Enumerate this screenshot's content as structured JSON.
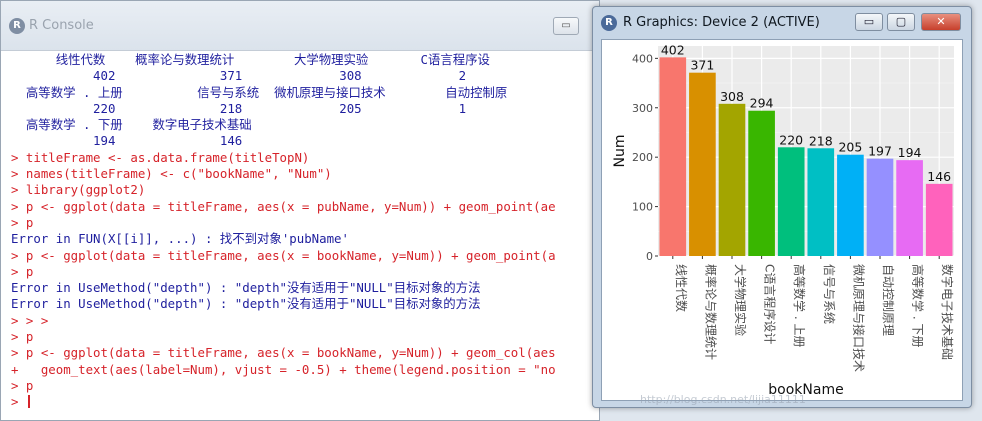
{
  "console": {
    "title": "R Console",
    "controls": {
      "minimize": "▭",
      "maximize": "▢"
    },
    "lines": [
      {
        "text": "      线性代数    概率论与数理统计        大学物理实验       C语言程序设",
        "color": "blue"
      },
      {
        "text": "           402              371             308             2",
        "color": "blue"
      },
      {
        "text": "  高等数学 . 上册          信号与系统  微机原理与接口技术        自动控制原",
        "color": "blue"
      },
      {
        "text": "           220              218             205             1",
        "color": "blue"
      },
      {
        "text": "  高等数学 . 下册    数字电子技术基础",
        "color": "blue"
      },
      {
        "text": "           194              146",
        "color": "blue"
      },
      {
        "text": "> titleFrame <- as.data.frame(titleTopN)",
        "color": "red"
      },
      {
        "text": "> names(titleFrame) <- c(\"bookName\", \"Num\")",
        "color": "red"
      },
      {
        "text": "> library(ggplot2)",
        "color": "red"
      },
      {
        "text": "> p <- ggplot(data = titleFrame, aes(x = pubName, y=Num)) + geom_point(ae",
        "color": "red"
      },
      {
        "text": "> p",
        "color": "red"
      },
      {
        "text": "Error in FUN(X[[i]], ...) : 找不到对象'pubName'",
        "color": "blue"
      },
      {
        "text": "> p <- ggplot(data = titleFrame, aes(x = bookName, y=Num)) + geom_point(a",
        "color": "red"
      },
      {
        "text": "> p",
        "color": "red"
      },
      {
        "text": "Error in UseMethod(\"depth\") : \"depth\"没有适用于\"NULL\"目标对象的方法",
        "color": "blue"
      },
      {
        "text": "Error in UseMethod(\"depth\") : \"depth\"没有适用于\"NULL\"目标对象的方法",
        "color": "blue"
      },
      {
        "text": "> > >",
        "color": "red"
      },
      {
        "text": "> p",
        "color": "red"
      },
      {
        "text": "> p <- ggplot(data = titleFrame, aes(x = bookName, y=Num)) + geom_col(aes",
        "color": "red"
      },
      {
        "text": "+   geom_text(aes(label=Num), vjust = -0.5) + theme(legend.position = \"no",
        "color": "red"
      },
      {
        "text": "> p",
        "color": "red"
      },
      {
        "text": "> ",
        "color": "red",
        "cursor": true
      }
    ]
  },
  "graphics": {
    "title": "R Graphics: Device 2 (ACTIVE)",
    "controls": {
      "minimize": "▭",
      "maximize": "▢",
      "close": "✕"
    }
  },
  "watermark": "http://blog.csdn.net/lijia11111",
  "chart_data": {
    "type": "bar",
    "categories": [
      "线性代数",
      "概率论与数理统计",
      "大学物理实验",
      "C语言程序设计",
      "高等数学 . 上册",
      "信号与系统",
      "微机原理与接口技术",
      "自动控制原理",
      "高等数学 . 下册",
      "数字电子技术基础"
    ],
    "values": [
      402,
      371,
      308,
      294,
      220,
      218,
      205,
      197,
      194,
      146
    ],
    "colors": [
      "#F8766D",
      "#D89000",
      "#A3A500",
      "#39B600",
      "#00BF7D",
      "#00BFC4",
      "#00B0F6",
      "#9590FF",
      "#E76BF3",
      "#FF62BC"
    ],
    "xlabel": "bookName",
    "ylabel": "Num",
    "yticks": [
      0,
      100,
      200,
      300,
      400
    ],
    "ylim": [
      0,
      425
    ],
    "grid": true,
    "panel_background": "#EBEBEB",
    "data_labels": true
  }
}
